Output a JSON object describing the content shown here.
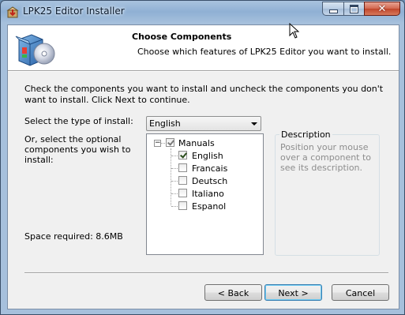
{
  "window": {
    "title": "LPK25 Editor Installer",
    "accent_color": "#8fb0d4"
  },
  "header": {
    "title": "Choose Components",
    "subtitle": "Choose which features of LPK25 Editor you want to install.",
    "logo_icon": "installer-box-cd-icon"
  },
  "body": {
    "intro": "Check the components you want to install and uncheck the components you don't want to install. Click Next to continue.",
    "install_type_label": "Select the type of install:",
    "install_type_value": "English",
    "optional_label": "Or, select the optional components you wish to install:",
    "space_required": "Space required: 8.6MB"
  },
  "tree": {
    "root": {
      "label": "Manuals",
      "expanded": true,
      "state": "partial"
    },
    "items": [
      {
        "label": "English",
        "checked": true
      },
      {
        "label": "Francais",
        "checked": false
      },
      {
        "label": "Deutsch",
        "checked": false
      },
      {
        "label": "Italiano",
        "checked": false
      },
      {
        "label": "Espanol",
        "checked": false
      }
    ]
  },
  "description": {
    "caption": "Description",
    "text": "Position your mouse over a component to see its description."
  },
  "buttons": {
    "back": "< Back",
    "next": "Next >",
    "cancel": "Cancel"
  }
}
